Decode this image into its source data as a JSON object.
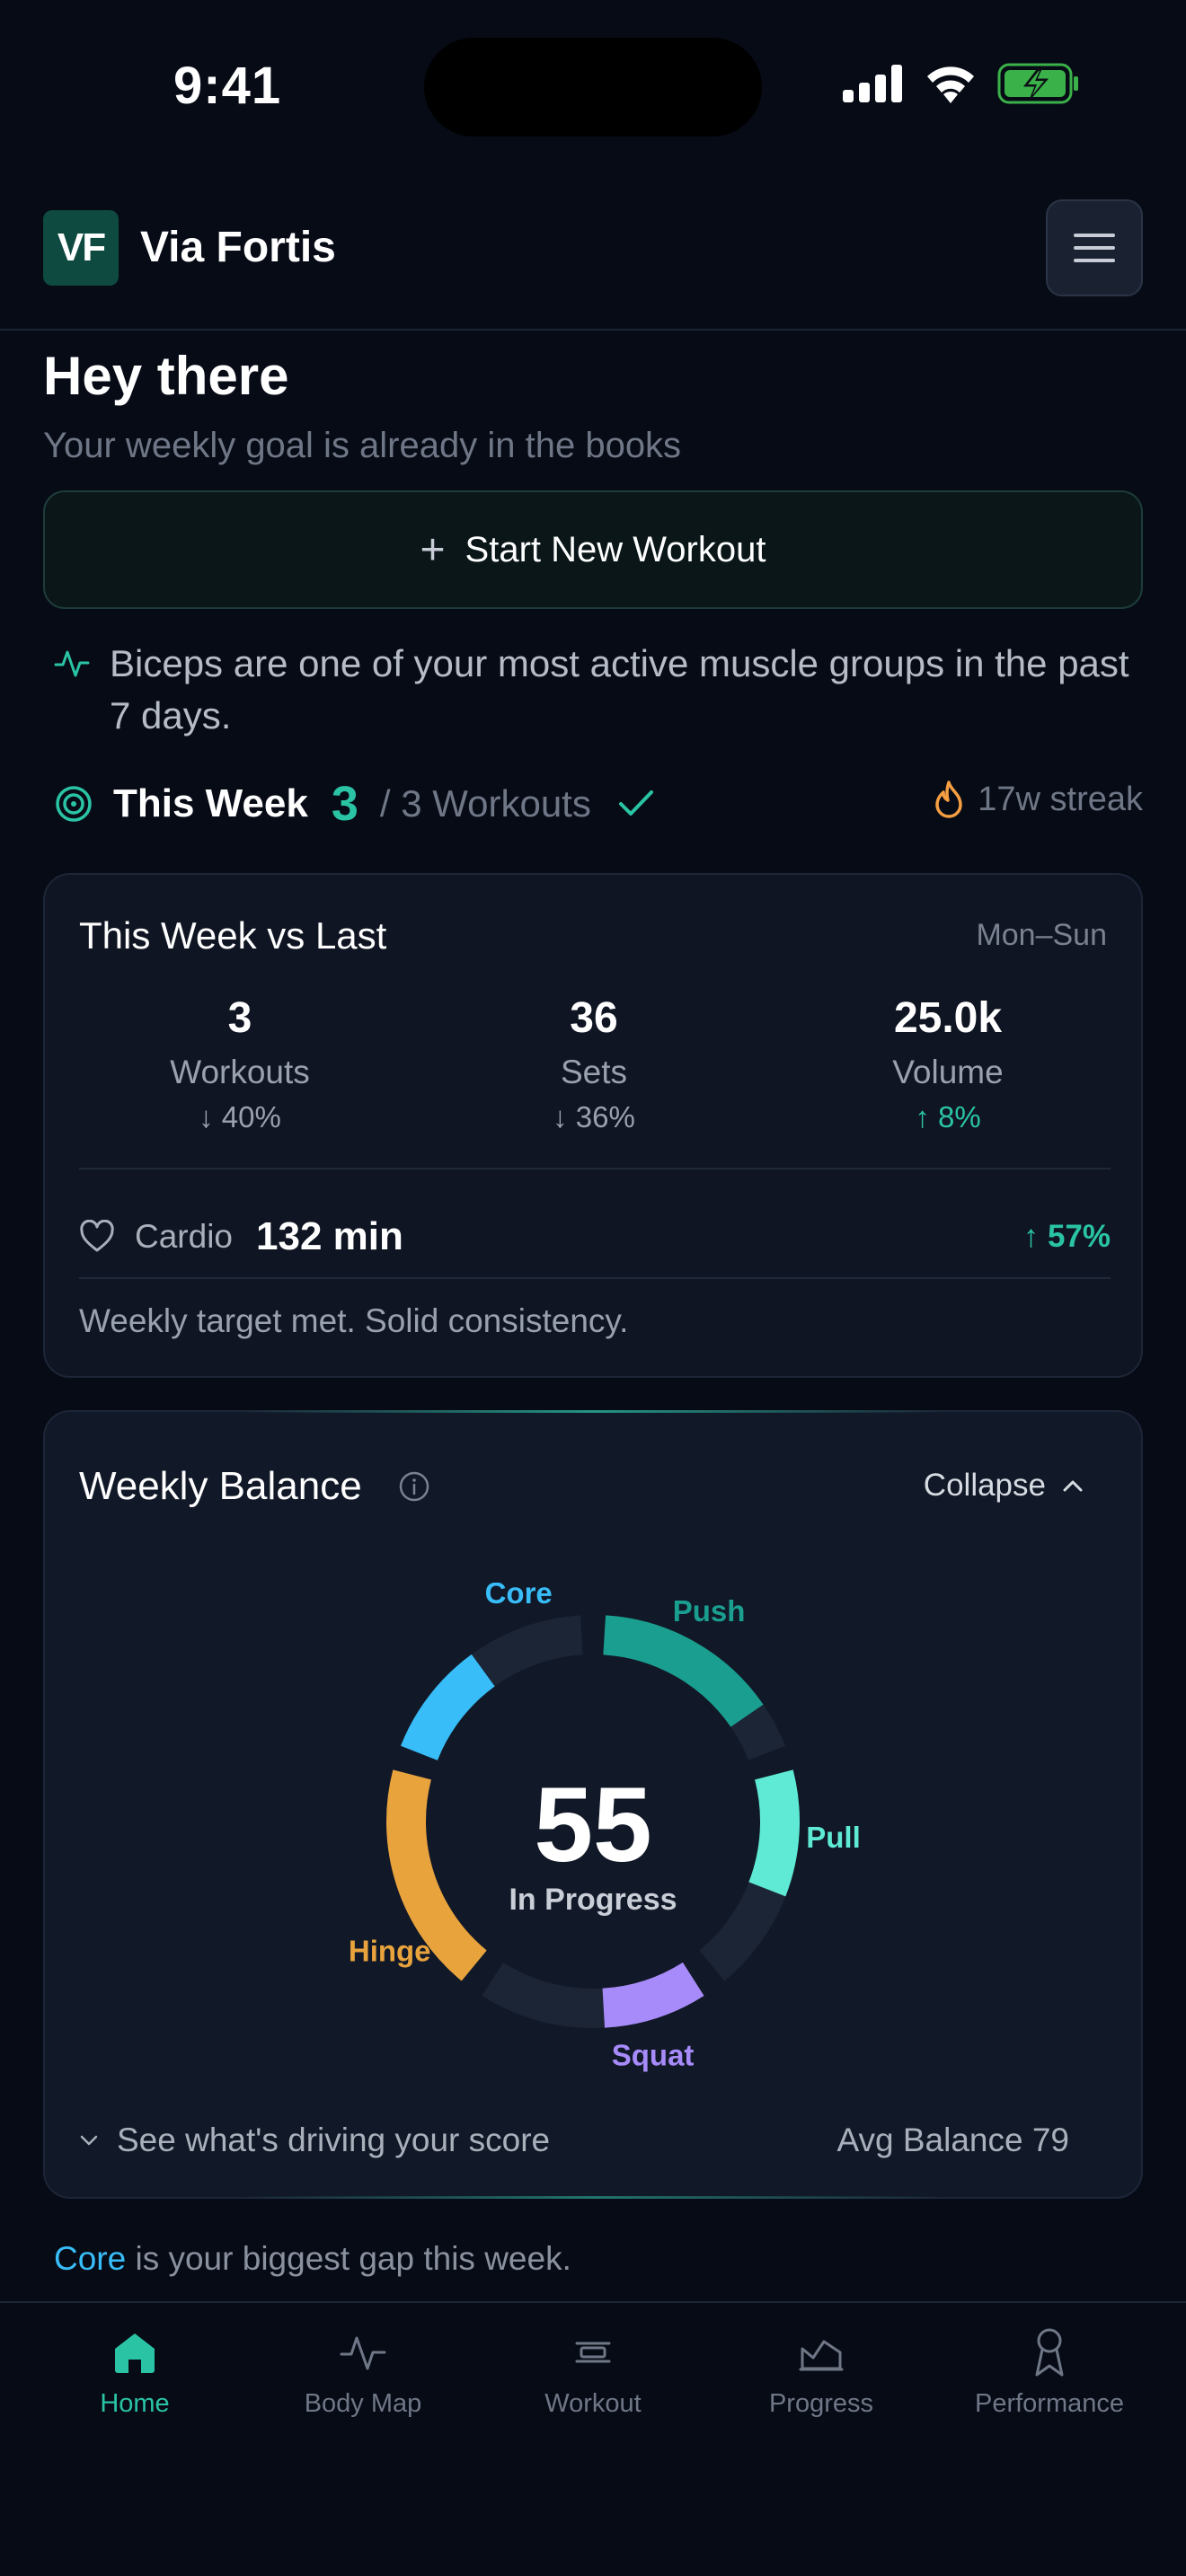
{
  "status": {
    "time": "9:41"
  },
  "header": {
    "logo_text": "VF",
    "app_name": "Via Fortis"
  },
  "greeting": {
    "title": "Hey there",
    "subtitle": "Your weekly goal is already in the books"
  },
  "start_button": {
    "label": "Start New Workout"
  },
  "insight": {
    "text": "Biceps are one of your most active muscle groups in the past 7 days."
  },
  "week_progress": {
    "label": "This Week",
    "count": "3",
    "total": "/ 3 Workouts",
    "streak": "17w streak"
  },
  "compare_card": {
    "title": "This Week vs Last",
    "range": "Mon–Sun",
    "stats": [
      {
        "value": "3",
        "label": "Workouts",
        "delta": "40%",
        "direction": "down"
      },
      {
        "value": "36",
        "label": "Sets",
        "delta": "36%",
        "direction": "down"
      },
      {
        "value": "25.0k",
        "label": "Volume",
        "delta": "8%",
        "direction": "up"
      }
    ],
    "cardio": {
      "label": "Cardio",
      "value": "132 min",
      "delta": "57%",
      "direction": "up"
    },
    "note": "Weekly target met. Solid consistency."
  },
  "balance_card": {
    "title": "Weekly Balance",
    "collapse_label": "Collapse",
    "score": "55",
    "score_label": "In Progress",
    "drivers_label": "See what's driving your score",
    "avg_balance": "Avg Balance 79",
    "segments": [
      {
        "name": "Push",
        "color": "#1a9e90",
        "label_color": "#1a9e90",
        "fill": 0.8
      },
      {
        "name": "Pull",
        "color": "#5eead4",
        "label_color": "#5eead4",
        "fill": 0.55
      },
      {
        "name": "Squat",
        "color": "#a78bfa",
        "label_color": "#a78bfa",
        "fill": 0.45
      },
      {
        "name": "Hinge",
        "color": "#e8a33d",
        "label_color": "#e8a33d",
        "fill": 1.0
      },
      {
        "name": "Core",
        "color": "#38bdf8",
        "label_color": "#38bdf8",
        "fill": 0.5
      }
    ]
  },
  "gap_note": {
    "highlight": "Core",
    "rest": " is your biggest gap this week."
  },
  "nav": {
    "items": [
      {
        "label": "Home",
        "icon": "home-icon",
        "active": true
      },
      {
        "label": "Body Map",
        "icon": "pulse-icon",
        "active": false
      },
      {
        "label": "Workout",
        "icon": "dumbbell-icon",
        "active": false
      },
      {
        "label": "Progress",
        "icon": "chart-icon",
        "active": false
      },
      {
        "label": "Performance",
        "icon": "award-icon",
        "active": false
      }
    ]
  },
  "colors": {
    "accent": "#2ac4a5",
    "background": "#070b16",
    "card": "#0f1522",
    "streak": "#f59e42"
  }
}
